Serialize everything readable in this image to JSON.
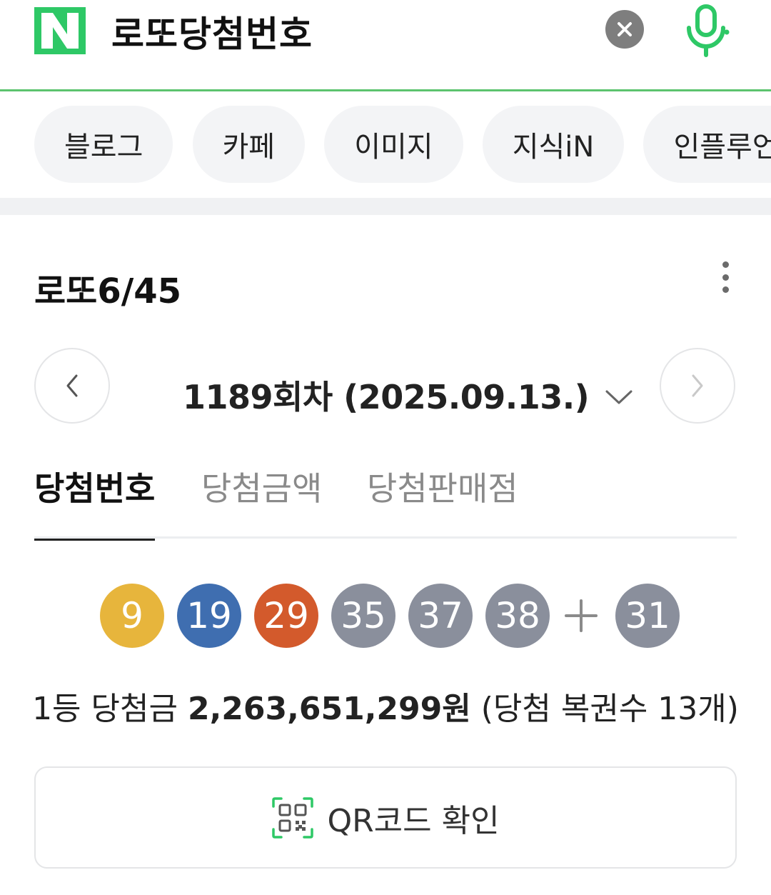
{
  "search": {
    "logo_letter": "N",
    "query": "로또당첨번호"
  },
  "colors": {
    "brand": "#03c75a",
    "ball_yellow": "#e7b53c",
    "ball_blue": "#3f6eb0",
    "ball_red": "#d35a2c",
    "ball_gray": "#8a8f9c"
  },
  "chips": [
    {
      "label": "블로그"
    },
    {
      "label": "카페"
    },
    {
      "label": "이미지"
    },
    {
      "label": "지식iN"
    },
    {
      "label": "인플루언"
    }
  ],
  "card": {
    "title": "로또6/45",
    "round": "1189회차 (2025.09.13.)",
    "tabs": [
      {
        "label": "당첨번호",
        "active": true
      },
      {
        "label": "당첨금액",
        "active": false
      },
      {
        "label": "당첨판매점",
        "active": false
      }
    ],
    "numbers": [
      "9",
      "19",
      "29",
      "35",
      "37",
      "38"
    ],
    "bonus": "31",
    "prize": {
      "prefix": "1등 당첨금",
      "amount": "2,263,651,299원",
      "suffix": "(당첨 복권수 13개)"
    },
    "qr_label": "QR코드 확인"
  },
  "icons": [
    "close-icon",
    "mic-icon",
    "more-vertical-icon",
    "chevron-left-icon",
    "chevron-right-icon",
    "chevron-down-icon",
    "plus-icon",
    "qr-code-icon"
  ]
}
